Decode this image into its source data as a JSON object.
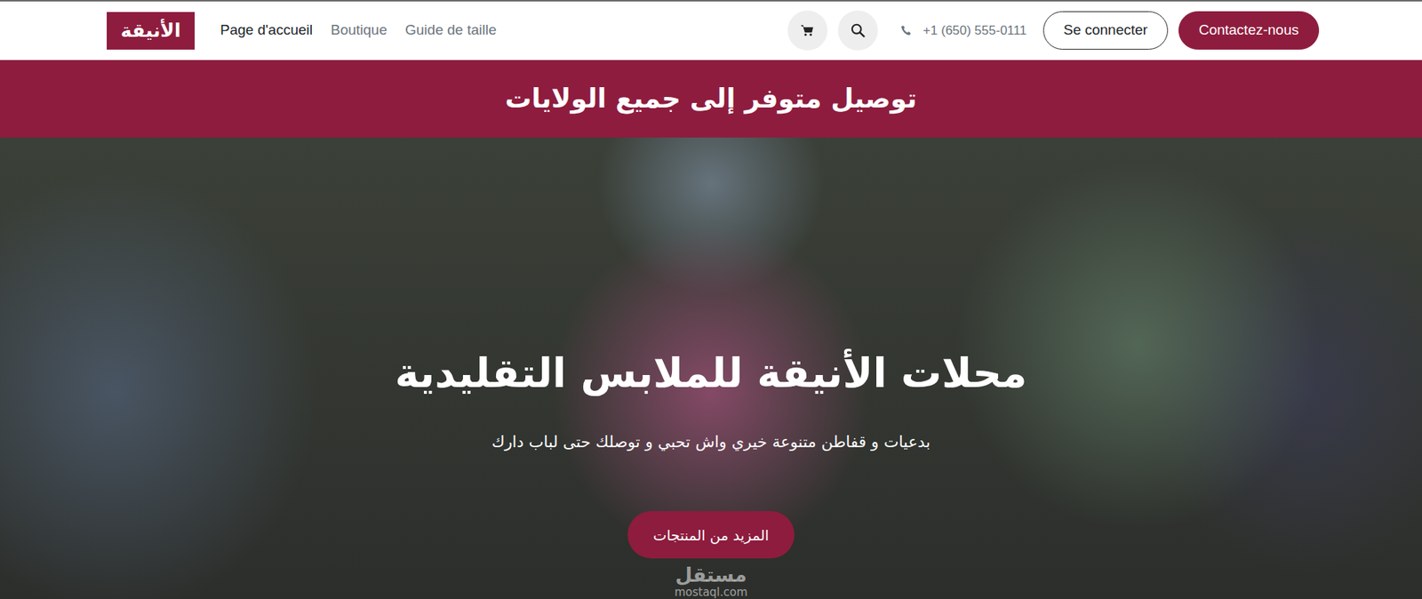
{
  "logo": {
    "text": "الأنيقة"
  },
  "nav": {
    "items": [
      {
        "label": "Page d'accueil",
        "selected": true
      },
      {
        "label": "Boutique",
        "selected": false
      },
      {
        "label": "Guide de taille",
        "selected": false
      }
    ]
  },
  "actions": {
    "phone": "+1 (650) 555-0111",
    "login": "Se connecter",
    "contact": "Contactez-nous"
  },
  "banner": {
    "text": "توصيل متوفر إلى جميع الولايات"
  },
  "hero": {
    "title": "محلات الأنيقة للملابس التقليدية",
    "subtitle": "بدعيات و قفاطن متنوعة خيري واش تحبي و توصلك حتى لباب دارك",
    "button": "المزيد من المنتجات"
  },
  "watermark": {
    "text": "مستقل",
    "url": "mostaql.com"
  }
}
